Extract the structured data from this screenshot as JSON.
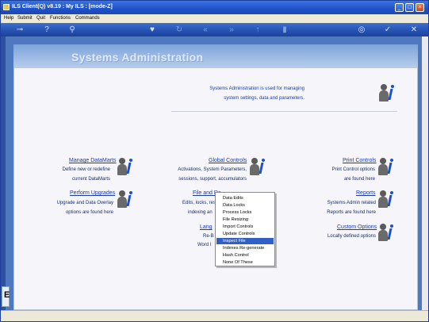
{
  "window": {
    "title": "ILS Client(Q) v8.19 : My ILS :     [mode-Z]"
  },
  "menu": [
    "Help",
    "Submit",
    "Quit",
    "Functions",
    "Commands"
  ],
  "toolbar": {
    "icons": [
      "key-icon",
      "help-icon",
      "search-icon",
      "heart-icon",
      "refresh-icon",
      "rewind-icon",
      "fast-forward-icon",
      "up-icon",
      "document-icon",
      "globe-icon",
      "check-icon",
      "close-icon"
    ]
  },
  "page": {
    "heading": "Systems Administration",
    "intro_line1": "Systems Administration is used for managing",
    "intro_line2": "system settings, data and parameters."
  },
  "sections": {
    "manage_datamarts": {
      "label": "Manage DataMarts",
      "desc1": "Define new or redefine",
      "desc2": "current DataMarts"
    },
    "global_controls": {
      "label": "Global Controls",
      "desc1": "Activations, System Parameters,",
      "desc2": "sessions, support, accumulators"
    },
    "print_controls": {
      "label": "Print Controls",
      "desc1": "Print Control options",
      "desc2": "are found here"
    },
    "perform_upgrades": {
      "label": "Perform Upgrades",
      "desc1": "Upgrade and Data Overlay",
      "desc2": "options are found here"
    },
    "file_and_data": {
      "label": "File and Da",
      "desc1": "Edits, locks, res",
      "desc2": "indexing an"
    },
    "reports": {
      "label": "Reports",
      "desc1": "Systems Admin related",
      "desc2": "Reports are found here"
    },
    "languages": {
      "label": "Lang",
      "desc1": "Re-B",
      "desc2": "Word I"
    },
    "custom_options": {
      "label": "Custom Options",
      "desc1": "Locally defined options"
    }
  },
  "context_menu": {
    "items": [
      "Data Edits",
      "Data Locks",
      "Process Locks",
      "File Resizing",
      "Import Controls",
      "Update Controls",
      "Inspect File",
      "Indexes Re-generate",
      "Hash Control",
      "None Of These"
    ],
    "selected": "Inspect File"
  },
  "side_tab": {
    "glyph": "E"
  },
  "colors": {
    "title_bar": "#1f52c8",
    "toolbar": "#2653b4",
    "desktop": "#4f78bf",
    "link": "#1a3aa8",
    "selection": "#3160c4"
  }
}
